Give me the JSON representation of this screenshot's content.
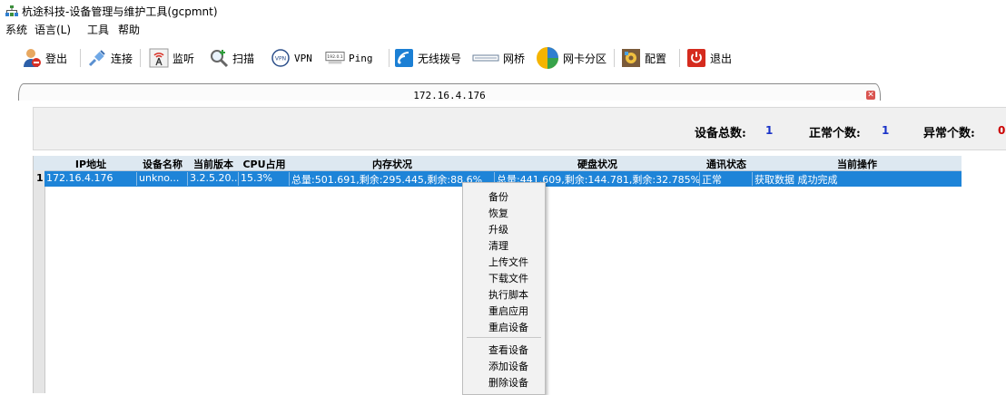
{
  "window": {
    "title": "杭途科技-设备管理与维护工具(gcpmnt)"
  },
  "menu": {
    "items": [
      "系统",
      "语言(L)",
      "工具",
      "帮助"
    ]
  },
  "toolbar": {
    "logout": "登出",
    "connect": "连接",
    "monitor": "监听",
    "scan": "扫描",
    "vpn": "VPN",
    "ping": "Ping",
    "wireless": "无线拨号",
    "bridge": "网桥",
    "nic_partition": "网卡分区",
    "config": "配置",
    "exit": "退出"
  },
  "tab": {
    "label": "172.16.4.176"
  },
  "summary": {
    "total_label": "设备总数:",
    "total_value": "1",
    "normal_label": "正常个数:",
    "normal_value": "1",
    "abnormal_label": "异常个数:",
    "abnormal_value": "0"
  },
  "table": {
    "headers": [
      "IP地址",
      "设备名称",
      "当前版本",
      "CPU占用",
      "内存状况",
      "硬盘状况",
      "通讯状态",
      "当前操作"
    ],
    "rows": [
      {
        "num": "1",
        "ip": "172.16.4.176",
        "name": "unkno...",
        "version": "3.2.5.20...",
        "cpu": "15.3%",
        "memory": "总量:501.691,剩余:295.445,剩余:88.6%",
        "disk": "总量:441.609,剩余:144.781,剩余:32.785%",
        "comm": "正常",
        "op": "获取数据 成功完成"
      }
    ]
  },
  "context_menu": {
    "group1": [
      "备份",
      "恢复",
      "升级",
      "清理",
      "上传文件",
      "下载文件",
      "执行脚本",
      "重启应用",
      "重启设备"
    ],
    "group2": [
      "查看设备",
      "添加设备",
      "删除设备"
    ]
  },
  "colors": {
    "selection": "#1e84d8",
    "header_bg": "#dde8f1",
    "value_blue": "#1a33c8",
    "value_red": "#cc0000"
  }
}
